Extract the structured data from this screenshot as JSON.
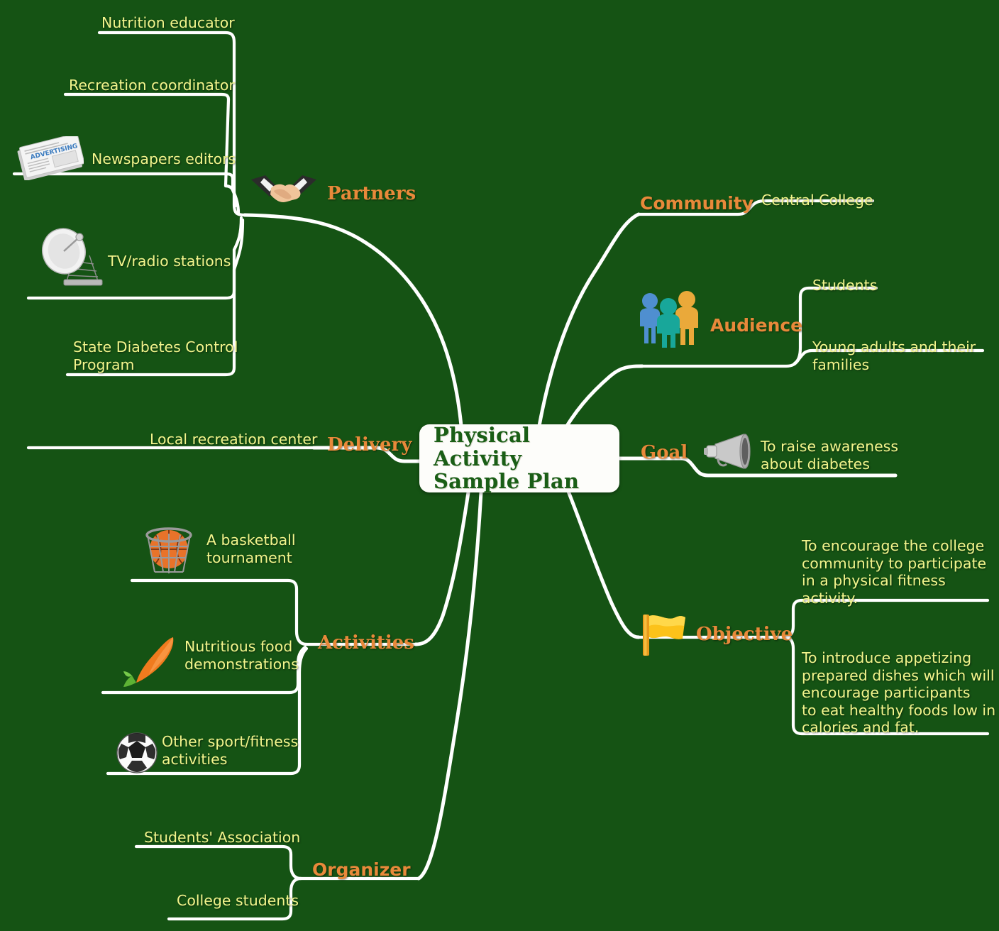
{
  "theme": {
    "background": "#155314",
    "branch_label_color": "#e8893a",
    "leaf_text_color": "#f2f58c",
    "wire_color": "#ffffff",
    "central_box_color": "#fdfdfa",
    "central_text_color": "#1a5e16"
  },
  "central": {
    "title_line1": "Physical Activity",
    "title_line2": "Sample Plan",
    "title": "Physical Activity Sample Plan"
  },
  "branches": {
    "partners": {
      "label": "Partners",
      "icon": "handshake-icon",
      "leaves": [
        {
          "text": "Nutrition educator",
          "icon": null
        },
        {
          "text": "Recreation coordinator",
          "icon": null
        },
        {
          "text": "Newspapers editors",
          "icon": "newspaper-advertising-icon"
        },
        {
          "text": "TV/radio stations",
          "icon": "satellite-dish-icon"
        },
        {
          "text": "State Diabetes Control\nProgram",
          "icon": null
        }
      ]
    },
    "community": {
      "label": "Community",
      "icon": null,
      "leaves": [
        {
          "text": "Central College",
          "icon": null
        }
      ]
    },
    "audience": {
      "label": "Audience",
      "icon": "three-people-icon",
      "leaves": [
        {
          "text": "Students",
          "icon": null
        },
        {
          "text": "Young adults and their\nfamilies",
          "icon": null
        }
      ]
    },
    "goal": {
      "label": "Goal",
      "icon": "megaphone-icon",
      "leaves": [
        {
          "text": "To raise awareness\nabout diabetes",
          "icon": null
        }
      ]
    },
    "objective": {
      "label": "Objective",
      "icon": "yellow-flag-icon",
      "leaves": [
        {
          "text": "To encourage the college\ncommunity to participate\nin a physical fitness\nactivity.",
          "icon": null
        },
        {
          "text": "To introduce appetizing\nprepared dishes which will\nencourage participants\nto eat healthy foods low in\ncalories and fat.",
          "icon": null
        }
      ]
    },
    "delivery": {
      "label": "Delivery",
      "icon": null,
      "leaves": [
        {
          "text": "Local recreation center",
          "icon": null
        }
      ]
    },
    "activities": {
      "label": "Activities",
      "icon": null,
      "leaves": [
        {
          "text": "A basketball\ntournament",
          "icon": "basketball-hoop-icon"
        },
        {
          "text": "Nutritious food\ndemonstrations",
          "icon": "carrot-icon"
        },
        {
          "text": "Other sport/fitness\nactivities",
          "icon": "soccer-ball-icon"
        }
      ]
    },
    "organizer": {
      "label": "Organizer",
      "icon": null,
      "leaves": [
        {
          "text": "Students' Association",
          "icon": null
        },
        {
          "text": "College students",
          "icon": null
        }
      ]
    }
  },
  "newspaper_icon_text": "ADVERTISING"
}
